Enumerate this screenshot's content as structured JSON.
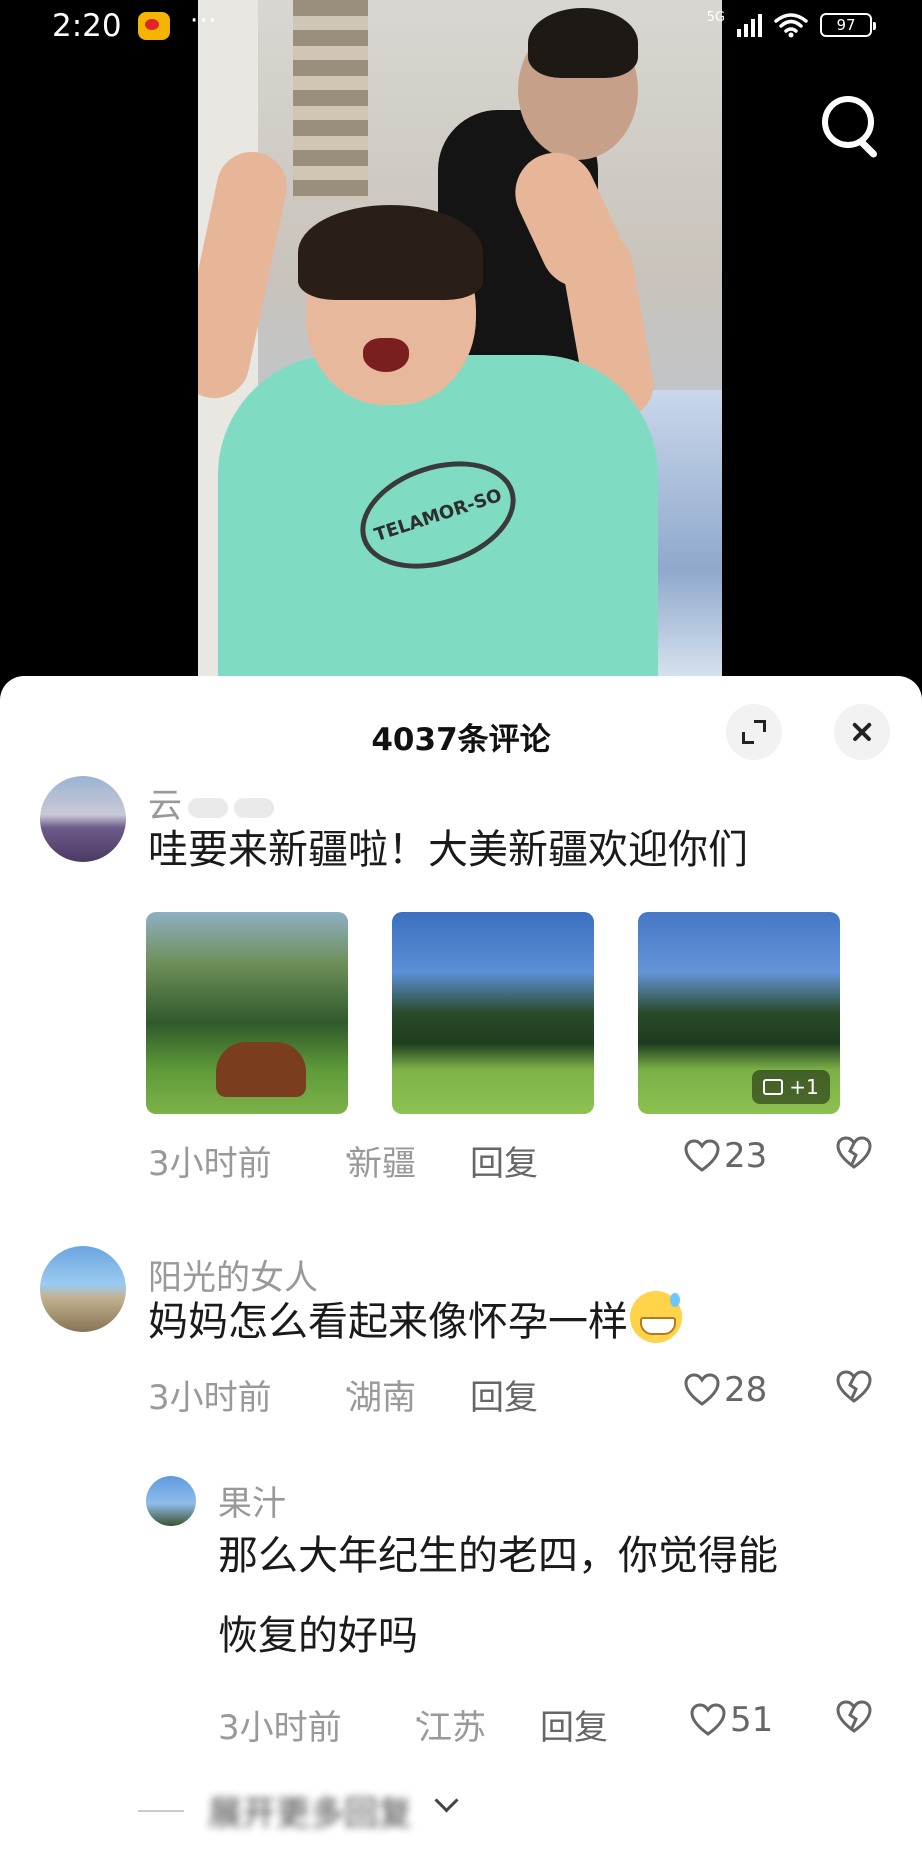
{
  "status_bar": {
    "time": "2:20",
    "dots": "···",
    "network": "5G",
    "battery": "97"
  },
  "video": {
    "shirt_text": "TELAMOR-SO"
  },
  "sheet": {
    "title": "4037条评论"
  },
  "comments": [
    {
      "user": "云",
      "text": "哇要来新疆啦！大美新疆欢迎你们",
      "image_badge": "+1",
      "time": "3小时前",
      "sep": "·",
      "region": "新疆",
      "reply": "回复",
      "likes": "23"
    },
    {
      "user": "阳光的女人",
      "text": "妈妈怎么看起来像怀孕一样",
      "time": "3小时前",
      "sep": "·",
      "region": "湖南",
      "reply": "回复",
      "likes": "28"
    }
  ],
  "reply": {
    "user": "果汁",
    "text_line1": "那么大年纪生的老四，你觉得能",
    "text_line2": "恢复的好吗",
    "time": "3小时前",
    "sep": "·",
    "region": "江苏",
    "reply": "回复",
    "likes": "51"
  },
  "expand_replies": {
    "label": "展开更多回复"
  },
  "colors": {
    "meta_gray": "#999999",
    "text": "#1a1a1a",
    "sheet_bg": "#ffffff"
  }
}
